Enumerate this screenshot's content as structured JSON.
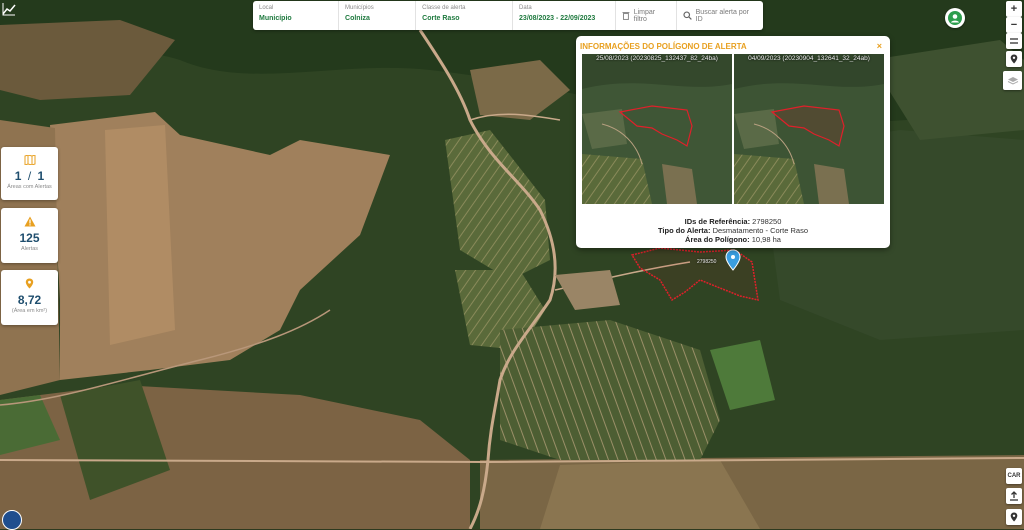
{
  "filters": {
    "local_label": "Local",
    "local_value": "Município",
    "municipio_label": "Municípios",
    "municipio_value": "Colniza",
    "classe_label": "Classe de alerta",
    "classe_value": "Corte Raso",
    "data_label": "Data",
    "data_value": "23/08/2023 - 22/09/2023",
    "clear_label": "Limpar filtro",
    "search_placeholder": "Buscar alerta por ID"
  },
  "stats": {
    "areas_value_a": "1",
    "areas_sep": "/",
    "areas_value_b": "1",
    "areas_label": "Áreas com Alertas",
    "alerts_value": "125",
    "alerts_label": "Alertas",
    "area_value": "8,72",
    "area_label": "(Área em km²)"
  },
  "popup": {
    "title": "INFORMAÇÕES DO POLÍGONO DE ALERTA",
    "close": "×",
    "image_before_caption": "25/08/2023 (20230825_132437_82_24ba)",
    "image_after_caption": "04/09/2023 (20230904_132641_32_24ab)",
    "ref_label": "IDs de Referência:",
    "ref_value": "2798250",
    "type_label": "Tipo do Alerta:",
    "type_value": "Desmatamento - Corte Raso",
    "area_label": "Área do Polígono:",
    "area_value": "10,98 ha"
  },
  "map": {
    "polygon_label": "2798250"
  },
  "controls": {
    "zoom_in": "+",
    "zoom_out": "−",
    "car_label": "CAR"
  },
  "colors": {
    "accent_green": "#1f7a3f",
    "popup_title": "#e8a020",
    "polygon": "#e0202a",
    "stat_blue": "#1f4e6e"
  }
}
